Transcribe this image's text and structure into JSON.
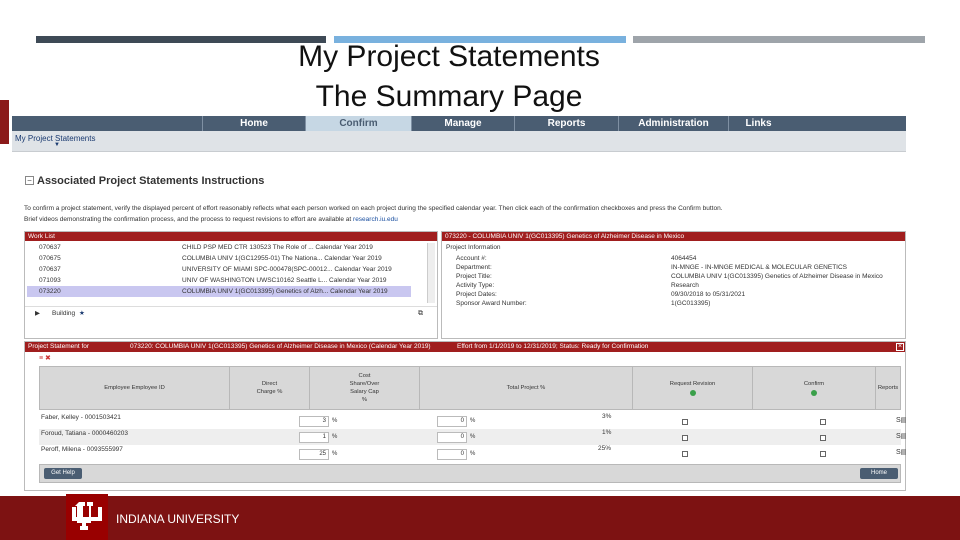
{
  "slide": {
    "title_line1": "My Project Statements",
    "title_line2": "The Summary Page",
    "footer_org": "INDIANA UNIVERSITY",
    "colors": {
      "crimson": "#7d1212",
      "nav": "#4a5d72",
      "panel_header": "#a01e1e"
    }
  },
  "nav": {
    "items": [
      {
        "label": "Home"
      },
      {
        "label": "Confirm",
        "active": true
      },
      {
        "label": "Manage"
      },
      {
        "label": "Reports"
      },
      {
        "label": "Administration"
      },
      {
        "label": "Links"
      }
    ]
  },
  "breadcrumb": "My Project Statements",
  "section": {
    "toggle": "−",
    "title": "Associated Project Statements Instructions",
    "instructions_line1": "To confirm a project statement, verify the displayed percent of effort reasonably reflects what each person worked on each project during the specified calendar year. Then click each of the confirmation checkboxes and press the Confirm button.",
    "instructions_line2": "Brief videos demonstrating the confirmation process, and the process to request revisions to effort are available at ",
    "instructions_link": "research.iu.edu"
  },
  "worklist": {
    "header": "Work List",
    "rows": [
      {
        "id": "070637",
        "desc": "CHILD PSP MED CTR 130523 The Role of ... Calendar Year 2019",
        "selected": false
      },
      {
        "id": "070675",
        "desc": "COLUMBIA UNIV 1(GC12955-01) The Nationa... Calendar Year 2019",
        "selected": false
      },
      {
        "id": "070637",
        "desc": "UNIVERSITY OF MIAMI SPC-000478(SPC-00012... Calendar Year 2019",
        "selected": false
      },
      {
        "id": "071093",
        "desc": "UNIV OF WASHINGTON UWSC10162 Seattle L... Calendar Year 2019",
        "selected": false
      },
      {
        "id": "073220",
        "desc": "COLUMBIA UNIV 1(GC013395) Genetics of Alzh... Calendar Year 2019",
        "selected": true
      }
    ],
    "footer_label": "Building",
    "star": "★",
    "expand_icon": "▶",
    "export_icon": "⧉"
  },
  "project_info": {
    "header": "073220 - COLUMBIA UNIV 1(GC013395) Genetics of Alzheimer Disease in Mexico",
    "heading": "Project Information",
    "fields": [
      {
        "key": "Account #:",
        "value": "4064454"
      },
      {
        "key": "Department:",
        "value": "IN-MNGE - IN-MNGE MEDICAL & MOLECULAR GENETICS"
      },
      {
        "key": "Project Title:",
        "value": "COLUMBIA UNIV 1(GC013395) Genetics of Alzheimer Disease in Mexico"
      },
      {
        "key": "Activity Type:",
        "value": "Research"
      },
      {
        "key": "Project Dates:",
        "value": "09/30/2018 to 05/31/2021"
      },
      {
        "key": "Sponsor Award Number:",
        "value": "1(GC013395)"
      }
    ]
  },
  "statement": {
    "header_left": "Project Statement for",
    "header_project": "073220: COLUMBIA UNIV 1(GC013395) Genetics of Alzheimer Disease in Mexico (Calendar Year 2019)",
    "header_effort": "Effort from 1/1/2019 to 12/31/2019;  Status: Ready for Confirmation",
    "close": "×",
    "tools": "≡  ✖",
    "columns": {
      "employee": "Employee   Employee ID",
      "direct_line1": "Direct",
      "direct_line2": "Charge %",
      "cost_line1": "Cost",
      "cost_line2": "Share/Over",
      "cost_line3": "Salary Cap",
      "cost_line4": "%",
      "total": "Total Project %",
      "revision": "Request Revision",
      "confirm": "Confirm",
      "reports": "Reports"
    },
    "rows": [
      {
        "name": "Faber, Kelley - 0001503421",
        "direct": "3",
        "cost": "0",
        "total": "3%"
      },
      {
        "name": "Foroud, Tatiana - 0000460203",
        "direct": "1",
        "cost": "0",
        "total": "1%"
      },
      {
        "name": "Peroff, Milena - 0093555997",
        "direct": "25",
        "cost": "0",
        "total": "25%"
      }
    ],
    "pct_sign": "%",
    "report_icon": "S▤",
    "get_help": "Get Help",
    "home": "Home"
  }
}
